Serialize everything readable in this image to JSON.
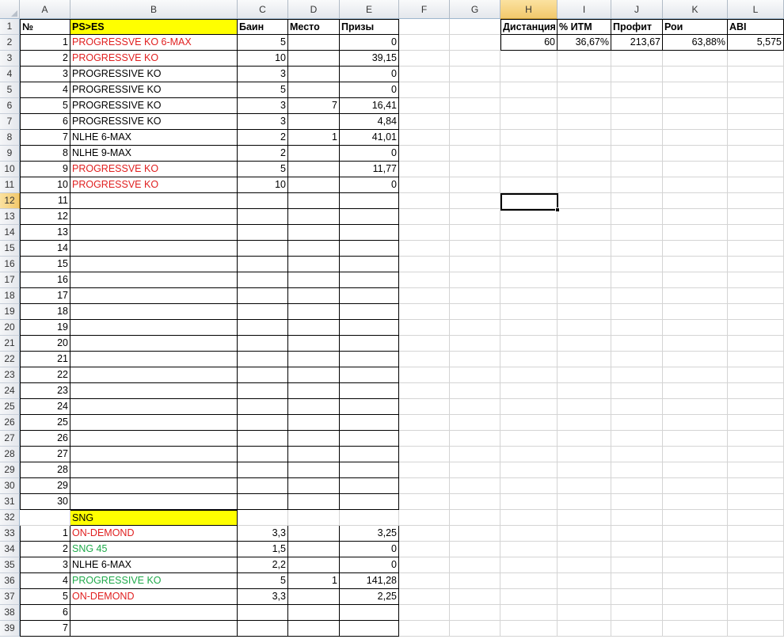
{
  "columns": [
    "A",
    "B",
    "C",
    "D",
    "E",
    "F",
    "G",
    "H",
    "I",
    "J",
    "K",
    "L"
  ],
  "selected_column": "H",
  "selected_row": 12,
  "active_cell": "H12",
  "row_headers": [
    1,
    2,
    3,
    4,
    5,
    6,
    7,
    8,
    9,
    10,
    11,
    12,
    13,
    14,
    15,
    16,
    17,
    18,
    19,
    20,
    21,
    22,
    23,
    24,
    25,
    26,
    27,
    28,
    29,
    30,
    31,
    32,
    33,
    34,
    35,
    36,
    37,
    38,
    39
  ],
  "main_table": {
    "headers": {
      "num": "№",
      "name": "PS>ES",
      "buyin": "Баин",
      "place": "Место",
      "prize": "Призы"
    },
    "rows": [
      {
        "num": "1",
        "name": "PROGRESSVE KO 6-MAX",
        "name_color": "red",
        "buyin": "5",
        "place": "",
        "prize": "0"
      },
      {
        "num": "2",
        "name": "PROGRESSVE KO",
        "name_color": "red",
        "buyin": "10",
        "place": "",
        "prize": "39,15"
      },
      {
        "num": "3",
        "name": "PROGRESSIVE KO",
        "name_color": "black",
        "buyin": "3",
        "place": "",
        "prize": "0"
      },
      {
        "num": "4",
        "name": "PROGRESSIVE KO",
        "name_color": "black",
        "buyin": "5",
        "place": "",
        "prize": "0"
      },
      {
        "num": "5",
        "name": "PROGRESSIVE KO",
        "name_color": "black",
        "buyin": "3",
        "place": "7",
        "prize": "16,41"
      },
      {
        "num": "6",
        "name": "PROGRESSIVE KO",
        "name_color": "black",
        "buyin": "3",
        "place": "",
        "prize": "4,84"
      },
      {
        "num": "7",
        "name": "NLHE 6-MAX",
        "name_color": "black",
        "buyin": "2",
        "place": "1",
        "prize": "41,01"
      },
      {
        "num": "8",
        "name": "NLHE 9-MAX",
        "name_color": "black",
        "buyin": "2",
        "place": "",
        "prize": "0"
      },
      {
        "num": "9",
        "name": "PROGRESSVE KO",
        "name_color": "red",
        "buyin": "5",
        "place": "",
        "prize": "11,77"
      },
      {
        "num": "10",
        "name": "PROGRESSVE KO",
        "name_color": "red",
        "buyin": "10",
        "place": "",
        "prize": "0"
      },
      {
        "num": "11",
        "name": "",
        "name_color": "black",
        "buyin": "",
        "place": "",
        "prize": ""
      },
      {
        "num": "12",
        "name": "",
        "name_color": "black",
        "buyin": "",
        "place": "",
        "prize": ""
      },
      {
        "num": "13",
        "name": "",
        "name_color": "black",
        "buyin": "",
        "place": "",
        "prize": ""
      },
      {
        "num": "14",
        "name": "",
        "name_color": "black",
        "buyin": "",
        "place": "",
        "prize": ""
      },
      {
        "num": "15",
        "name": "",
        "name_color": "black",
        "buyin": "",
        "place": "",
        "prize": ""
      },
      {
        "num": "16",
        "name": "",
        "name_color": "black",
        "buyin": "",
        "place": "",
        "prize": ""
      },
      {
        "num": "17",
        "name": "",
        "name_color": "black",
        "buyin": "",
        "place": "",
        "prize": ""
      },
      {
        "num": "18",
        "name": "",
        "name_color": "black",
        "buyin": "",
        "place": "",
        "prize": ""
      },
      {
        "num": "19",
        "name": "",
        "name_color": "black",
        "buyin": "",
        "place": "",
        "prize": ""
      },
      {
        "num": "20",
        "name": "",
        "name_color": "black",
        "buyin": "",
        "place": "",
        "prize": ""
      },
      {
        "num": "21",
        "name": "",
        "name_color": "black",
        "buyin": "",
        "place": "",
        "prize": ""
      },
      {
        "num": "22",
        "name": "",
        "name_color": "black",
        "buyin": "",
        "place": "",
        "prize": ""
      },
      {
        "num": "23",
        "name": "",
        "name_color": "black",
        "buyin": "",
        "place": "",
        "prize": ""
      },
      {
        "num": "24",
        "name": "",
        "name_color": "black",
        "buyin": "",
        "place": "",
        "prize": ""
      },
      {
        "num": "25",
        "name": "",
        "name_color": "black",
        "buyin": "",
        "place": "",
        "prize": ""
      },
      {
        "num": "26",
        "name": "",
        "name_color": "black",
        "buyin": "",
        "place": "",
        "prize": ""
      },
      {
        "num": "27",
        "name": "",
        "name_color": "black",
        "buyin": "",
        "place": "",
        "prize": ""
      },
      {
        "num": "28",
        "name": "",
        "name_color": "black",
        "buyin": "",
        "place": "",
        "prize": ""
      },
      {
        "num": "29",
        "name": "",
        "name_color": "black",
        "buyin": "",
        "place": "",
        "prize": ""
      },
      {
        "num": "30",
        "name": "",
        "name_color": "black",
        "buyin": "",
        "place": "",
        "prize": ""
      }
    ]
  },
  "sng_table": {
    "label": "SNG",
    "rows": [
      {
        "num": "1",
        "name": "ON-DEMOND",
        "name_color": "red",
        "buyin": "3,3",
        "place": "",
        "prize": "3,25"
      },
      {
        "num": "2",
        "name": "SNG 45",
        "name_color": "green",
        "buyin": "1,5",
        "place": "",
        "prize": "0"
      },
      {
        "num": "3",
        "name": "NLHE 6-MAX",
        "name_color": "black",
        "buyin": "2,2",
        "place": "",
        "prize": "0"
      },
      {
        "num": "4",
        "name": "PROGRESSIVE KO",
        "name_color": "green",
        "buyin": "5",
        "place": "1",
        "prize": "141,28"
      },
      {
        "num": "5",
        "name": "ON-DEMOND",
        "name_color": "red",
        "buyin": "3,3",
        "place": "",
        "prize": "2,25"
      },
      {
        "num": "6",
        "name": "",
        "name_color": "black",
        "buyin": "",
        "place": "",
        "prize": ""
      },
      {
        "num": "7",
        "name": "",
        "name_color": "black",
        "buyin": "",
        "place": "",
        "prize": ""
      }
    ]
  },
  "stats": {
    "headers": [
      "Дистанция",
      "% ИТМ",
      "Профит",
      "Рои",
      "ABI"
    ],
    "values": [
      "60",
      "36,67%",
      "213,67",
      "63,88%",
      "5,575"
    ]
  },
  "colors": {
    "yellow_fill": "#ffff00",
    "red_text": "#e02020",
    "green_text": "#1faa4a",
    "selected_header": "#f2c86c"
  }
}
